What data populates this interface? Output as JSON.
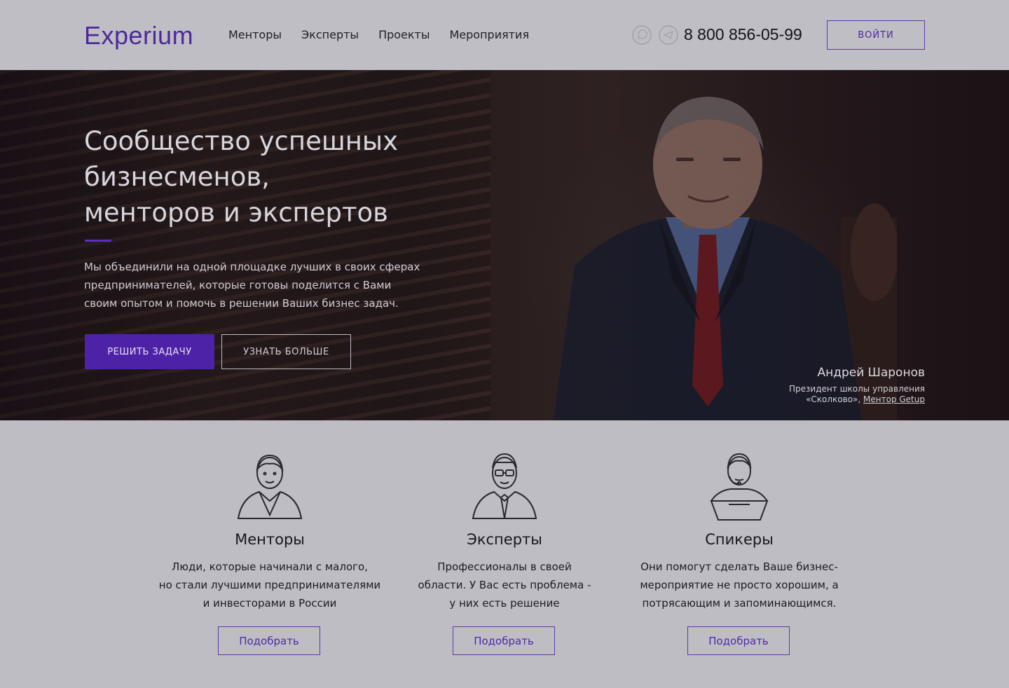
{
  "header": {
    "logo": "Experium",
    "nav": [
      "Менторы",
      "Эксперты",
      "Проекты",
      "Мероприятия"
    ],
    "phone": "8 800 856-05-99",
    "login": "ВОЙТИ"
  },
  "hero": {
    "title_lines": [
      "Сообщество успешных",
      "бизнесменов,",
      "менторов и экспертов"
    ],
    "text_lines": [
      "Мы объединили на одной площадке лучших в своих сферах",
      "предпринимателей, которые готовы поделится с Вами",
      "своим опытом и помочь в решении Ваших бизнес задач."
    ],
    "primary_button": "РЕШИТЬ ЗАДАЧУ",
    "secondary_button": "УЗНАТЬ БОЛЬШЕ",
    "caption": {
      "name": "Андрей Шаронов",
      "role_line1": "Президент школы управления",
      "role_line2": "«Сколково», ",
      "link": "Ментор Getup"
    }
  },
  "features": [
    {
      "title": "Менторы",
      "lines": [
        "Люди, которые начинали с  малого,",
        "но стали лучшими предпринимателями",
        "и инвесторами в России"
      ],
      "button": "Подобрать"
    },
    {
      "title": "Эксперты",
      "lines": [
        "Профессионалы в своей",
        "области.  У Вас есть проблема -",
        "у них есть решение"
      ],
      "button": "Подобрать"
    },
    {
      "title": "Спикеры",
      "lines": [
        "Они помогут сделать Ваше бизнес-",
        "мероприятие не просто хорошим, а",
        "потрясающим и запоминающимся."
      ],
      "button": "Подобрать"
    }
  ],
  "colors": {
    "brand": "#4c2a9a",
    "accent": "#4e22a6",
    "page_bg": "#bebdc4"
  },
  "icons": {
    "whatsapp": "whatsapp-icon",
    "telegram": "telegram-icon"
  }
}
